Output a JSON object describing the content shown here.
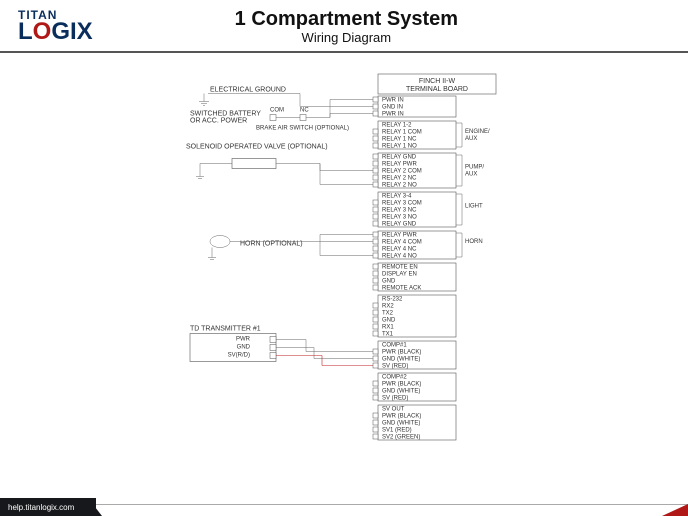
{
  "logo": {
    "top": "TITAN",
    "bottom_left": "L",
    "bottom_accent": "O",
    "bottom_right": "GIX"
  },
  "header": {
    "title": "1 Compartment System",
    "subtitle": "Wiring Diagram"
  },
  "footer": {
    "url": "help.titanlogix.com"
  },
  "terminal_board": {
    "title_line1": "FINCH II-W",
    "title_line2": "TERMINAL BOARD",
    "groups": [
      {
        "pins": [
          "PWR IN",
          "GND IN",
          "PWR IN"
        ]
      },
      {
        "title": "RELAY 1-2",
        "side": "ENGINE/\nAUX",
        "pins": [
          "RELAY 1 COM",
          "RELAY 1 NC",
          "RELAY 1 NO"
        ]
      },
      {
        "side": "PUMP/\nAUX",
        "pins": [
          "RELAY GND",
          "RELAY PWR",
          "RELAY 2 COM",
          "RELAY 2 NC",
          "RELAY 2 NO"
        ]
      },
      {
        "title": "RELAY 3-4",
        "side": "LIGHT",
        "pins": [
          "RELAY 3 COM",
          "RELAY 3 NC",
          "RELAY 3 NO",
          "RELAY GND"
        ]
      },
      {
        "side": "HORN",
        "pins": [
          "RELAY PWR",
          "RELAY 4 COM",
          "RELAY 4 NC",
          "RELAY 4 NO"
        ]
      },
      {
        "pins": [
          "REMOTE EN",
          "DISPLAY EN",
          "GND",
          "REMOTE ACK"
        ]
      },
      {
        "title": "RS-232",
        "pins": [
          "RX2",
          "TX2",
          "GND",
          "RX1",
          "TX1"
        ]
      },
      {
        "title": "COMP#1",
        "pins": [
          "PWR (BLACK)",
          "GND (WHITE)",
          "SV (RED)"
        ]
      },
      {
        "title": "COMP#2",
        "pins": [
          "PWR (BLACK)",
          "GND (WHITE)",
          "SV (RED)"
        ]
      },
      {
        "title": "SV OUT",
        "pins": [
          "PWR (BLACK)",
          "GND (WHITE)",
          "SV1 (RED)",
          "SV2 (GREEN)"
        ]
      }
    ]
  },
  "left_labels": {
    "electrical_ground": "ELECTRICAL GROUND",
    "switched_battery": "SWITCHED BATTERY\nOR ACC. POWER",
    "com": "COM",
    "nc": "NC",
    "brake_air": "BRAKE AIR SWITCH (OPTIONAL)",
    "solenoid": "SOLENOID OPERATED VALVE (OPTIONAL)",
    "horn": "HORN (OPTIONAL)",
    "transmitter": {
      "title": "TD TRANSMITTER #1",
      "pins": [
        "PWR",
        "GND",
        "SV(R/D)"
      ]
    }
  }
}
